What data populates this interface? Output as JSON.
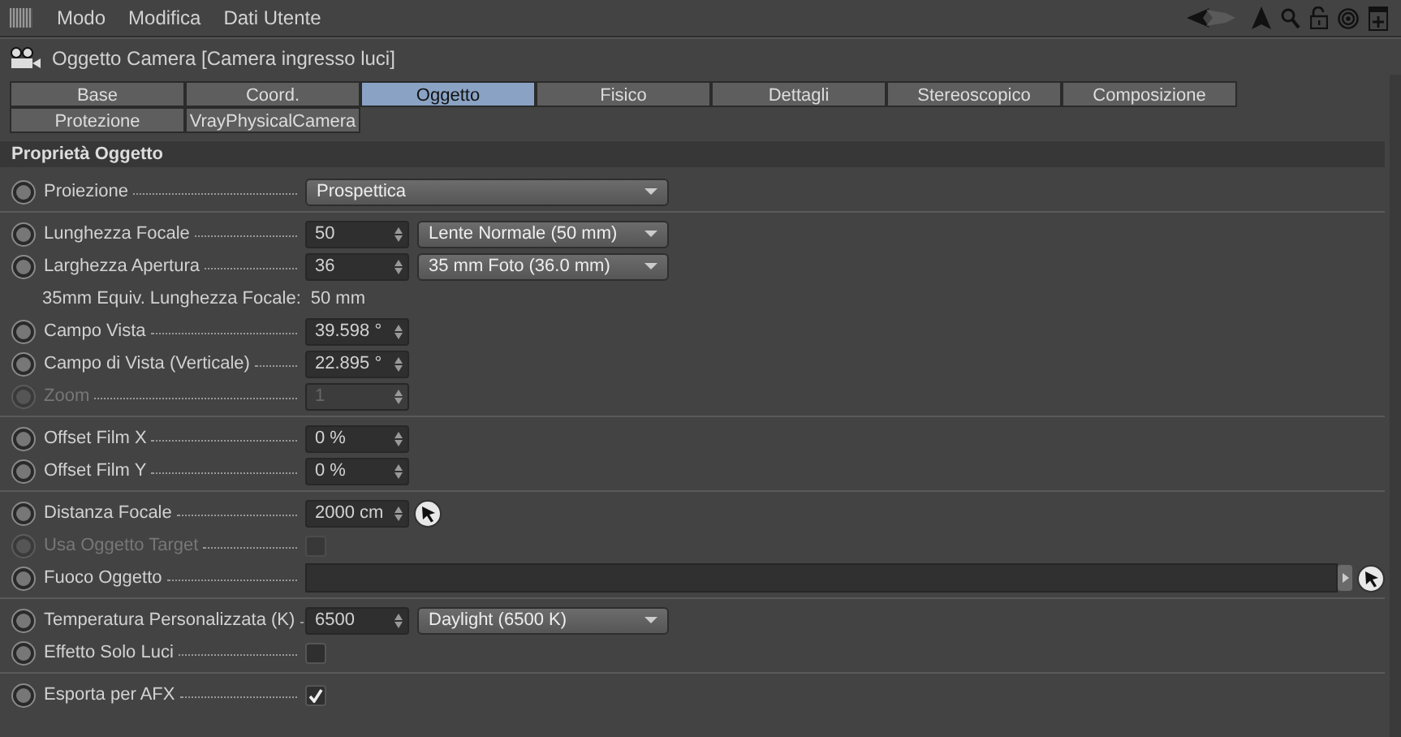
{
  "menu": [
    "Modo",
    "Modifica",
    "Dati Utente"
  ],
  "title": "Oggetto Camera [Camera ingresso luci]",
  "tabs": [
    {
      "label": "Base",
      "selected": false
    },
    {
      "label": "Coord.",
      "selected": false
    },
    {
      "label": "Oggetto",
      "selected": true
    },
    {
      "label": "Fisico",
      "selected": false
    },
    {
      "label": "Dettagli",
      "selected": false
    },
    {
      "label": "Stereoscopico",
      "selected": false
    },
    {
      "label": "Composizione",
      "selected": false
    },
    {
      "label": "Protezione",
      "selected": false
    },
    {
      "label": "VrayPhysicalCamera",
      "selected": false
    }
  ],
  "section": "Proprietà Oggetto",
  "groups": [
    {
      "rows": [
        {
          "kind": "dropdown",
          "label": "Proiezione",
          "disabled": false,
          "choice": "Prospettica"
        }
      ]
    },
    {
      "rows": [
        {
          "kind": "number",
          "label": "Lunghezza Focale",
          "disabled": false,
          "value": "50",
          "choice": "Lente Normale (50 mm)"
        },
        {
          "kind": "number",
          "label": "Larghezza Apertura",
          "disabled": false,
          "value": "36",
          "choice": "35 mm Foto (36.0 mm)"
        },
        {
          "kind": "info",
          "label": "35mm Equiv. Lunghezza Focale:",
          "value": "50 mm"
        },
        {
          "kind": "number",
          "label": "Campo Vista",
          "disabled": false,
          "value": "39.598 °"
        },
        {
          "kind": "number",
          "label": "Campo di Vista (Verticale)",
          "disabled": false,
          "value": "22.895 °"
        },
        {
          "kind": "number",
          "label": "Zoom",
          "disabled": true,
          "value": "1"
        }
      ]
    },
    {
      "rows": [
        {
          "kind": "number",
          "label": "Offset Film X",
          "disabled": false,
          "value": "0 %"
        },
        {
          "kind": "number",
          "label": "Offset Film Y",
          "disabled": false,
          "value": "0 %"
        }
      ]
    },
    {
      "rows": [
        {
          "kind": "number",
          "label": "Distanza Focale",
          "disabled": false,
          "value": "2000 cm",
          "picker": true
        },
        {
          "kind": "checkbox",
          "label": "Usa Oggetto Target",
          "disabled": true,
          "checked": false
        },
        {
          "kind": "link",
          "label": "Fuoco Oggetto",
          "disabled": false,
          "picker": true
        }
      ]
    },
    {
      "rows": [
        {
          "kind": "number",
          "label": "Temperatura Personalizzata (K)",
          "disabled": false,
          "value": "6500",
          "choice": "Daylight (6500 K)"
        },
        {
          "kind": "checkbox",
          "label": "Effetto Solo Luci",
          "disabled": false,
          "checked": false
        }
      ]
    },
    {
      "rows": [
        {
          "kind": "checkbox",
          "label": "Esporta per AFX",
          "disabled": false,
          "checked": true
        }
      ]
    }
  ]
}
